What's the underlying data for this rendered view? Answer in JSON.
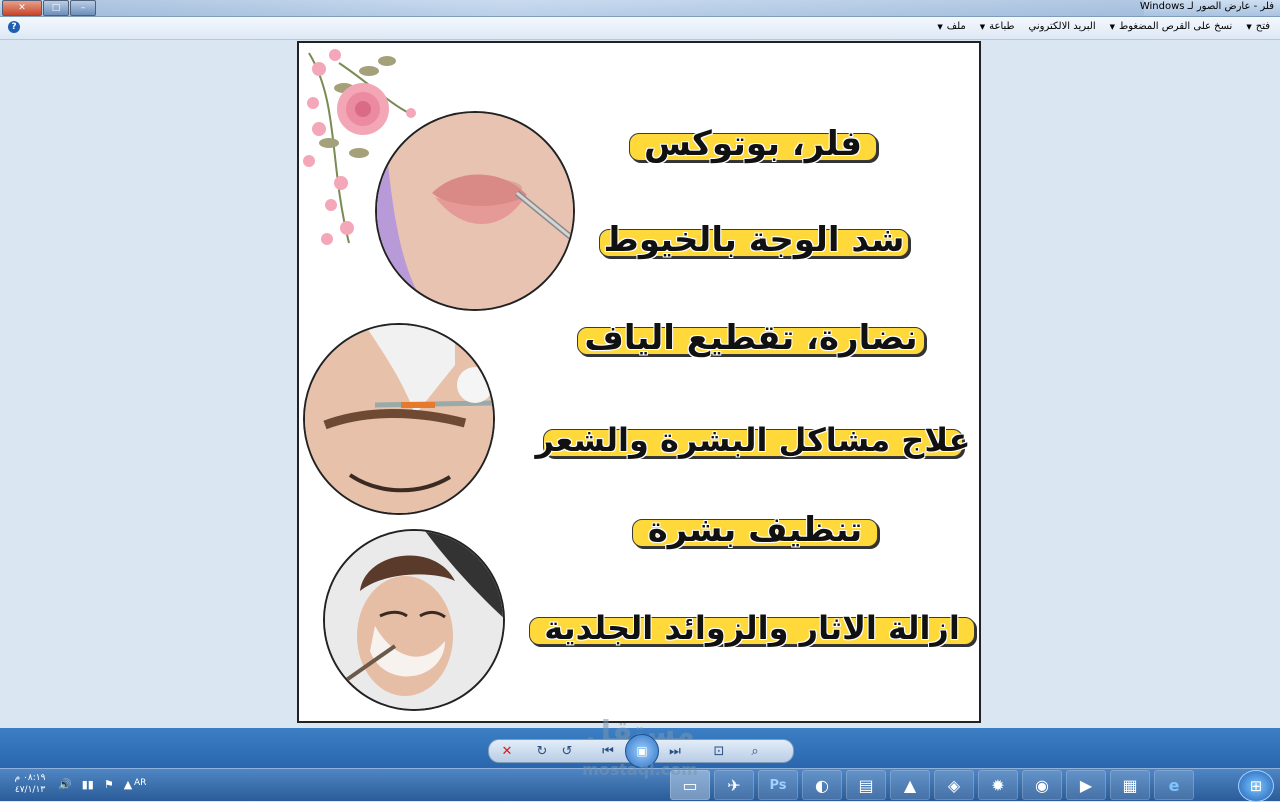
{
  "window": {
    "title": "فلر - عارض الصور لـ Windows",
    "close_glyph": "✕",
    "maximize_glyph": "□",
    "minimize_glyph": "–"
  },
  "menu": {
    "items": [
      {
        "label": "ملف"
      },
      {
        "label": "طباعة"
      },
      {
        "label": "البريد الالكتروني"
      },
      {
        "label": "نسخ على القرص المضغوط"
      },
      {
        "label": "فتح"
      }
    ],
    "help_glyph": "?"
  },
  "poster": {
    "lines": [
      "فلر، بوتوكس",
      "شد الوجة بالخيوط",
      "نضارة، تقطيع الياف",
      "علاج مشاكل البشرة والشعر",
      "تنظيف بشرة",
      "ازالة الاثار والزوائد الجلدية"
    ]
  },
  "watermark": {
    "text": "مستقل",
    "sub": "mostaql.com"
  },
  "controls": {
    "delete_icon": "✕",
    "rotate_right_icon": "↻",
    "rotate_left_icon": "↺",
    "prev_icon": "⏮",
    "play_icon": "▣",
    "next_icon": "⏭",
    "fit_icon": "⊡",
    "zoom_icon": "⌕"
  },
  "taskbar": {
    "time": "٠٨:١٩ م",
    "date": "٤٧/١/١٣",
    "lang": "AR",
    "tray_icons": [
      "🔊",
      "▮▮",
      "⚑",
      "▲"
    ],
    "tasks": [
      {
        "name": "photo-viewer",
        "glyph": "▭",
        "active": true
      },
      {
        "name": "telegram",
        "glyph": "✈"
      },
      {
        "name": "photoshop",
        "glyph": "Ps"
      },
      {
        "name": "edge",
        "glyph": "◐"
      },
      {
        "name": "app-5",
        "glyph": "▤"
      },
      {
        "name": "app-6",
        "glyph": "▲"
      },
      {
        "name": "app-7",
        "glyph": "◈"
      },
      {
        "name": "app-8",
        "glyph": "✹"
      },
      {
        "name": "chrome",
        "glyph": "◉"
      },
      {
        "name": "media-player",
        "glyph": "▶"
      },
      {
        "name": "explorer",
        "glyph": "▦"
      },
      {
        "name": "internet-explorer",
        "glyph": "e"
      }
    ],
    "start_glyph": "⊞"
  },
  "colors": {
    "banner": "#ffd83a",
    "taskbar": "#2a5c99"
  }
}
